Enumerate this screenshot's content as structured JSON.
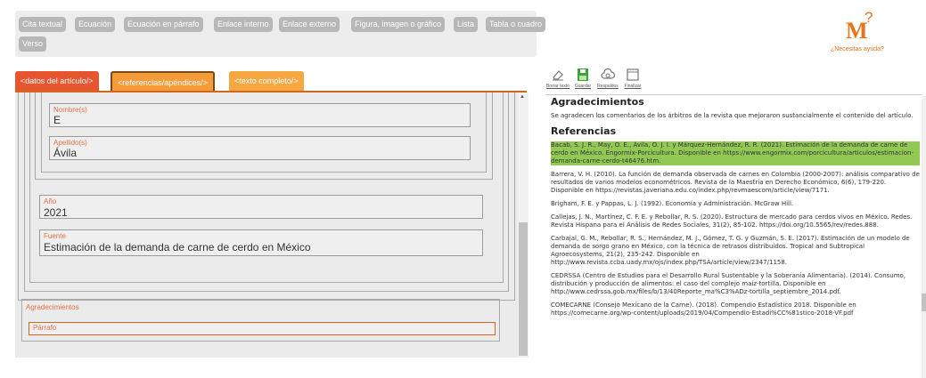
{
  "toolbar": {
    "buttons": [
      "Cita textual",
      "Ecuación",
      "Ecuación en párrafo",
      "Enlace interno",
      "Enlace externo",
      "Figura, imagen o gráfico",
      "Lista",
      "Tabla o cuadro",
      "Verso"
    ]
  },
  "help": {
    "logo": "M",
    "question_mark": "?",
    "text": "¿Necesitas ayuda?"
  },
  "tabs": [
    {
      "label": "<datos del artículo/>",
      "color": "#e8542e"
    },
    {
      "label": "<referencias/apéndices/>",
      "color": "#f59b3a"
    },
    {
      "label": "<texto completo/>",
      "color": "#f5a742"
    }
  ],
  "form": {
    "nombre": {
      "label": "Nombre(s)",
      "value": "E"
    },
    "apellido": {
      "label": "Apellido(s)",
      "value": "Ávila"
    },
    "anio": {
      "label": "Año",
      "value": "2021"
    },
    "fuente": {
      "label": "Fuente",
      "value": "Estimación de la demanda de carne de cerdo en México"
    },
    "agradecimientos": {
      "label": "Agradecimientos"
    },
    "parrafo": {
      "label": "Párrafo"
    }
  },
  "editor_tools": [
    {
      "icon": "eraser-icon",
      "label": "Borrar texto"
    },
    {
      "icon": "save-icon",
      "label": "Guardar"
    },
    {
      "icon": "cloud-icon",
      "label": "Respaldos"
    },
    {
      "icon": "finalize-icon",
      "label": "Finalizar"
    }
  ],
  "editor": {
    "agradecimientos_title": "Agradecimientos",
    "agradecimientos_text": "Se agradecen los comentarios de los árbitros de la revista que mejoraron sustancialmente el contenido del artículo.",
    "referencias_title": "Referencias",
    "references": [
      "Bacab, S. J. R., May, O. E., Ávila, O. J. I. y Márquez-Hernández, R. R. (2021). Estimación de la demanda de carne de cerdo en México. Engormix-Porcicultura. Disponible en https://www.engormix.com/porcicultura/articulos/estimacion-demanda-carne-cerdo-t46476.htm.",
      "Barrera, V. H. (2010). La función de demanda observada de carnes en Colombia (2000-2007): análisis comparativo de resultados de varios modelos econométricos. Revista de la Maestría en Derecho Económico, 6(6), 179-220. Disponible en https://revistas.javeriana.edu.co/index.php/revmaescom/article/view/7171.",
      "Brigham, F. E. y Pappas, L. J. (1992). Economía y Administración. McGraw Hill.",
      "Callejas, J. N., Martínez, C. F. E. y Rebollar, R. S. (2020). Estructura de mercado para cerdos vivos en México. Redes. Revista Hispana para el Análisis de Redes Sociales, 31(2), 85-102. https://doi.org/10.5565/rev/redes.888.",
      "Carbajal, G. M., Rebollar, R. S., Hernández, M. J., Gómez, T. G. y Guzmán, S. E. (2017). Estimación de un modelo de demanda de sorgo grano en México, con la técnica de retrasos distribuidos. Tropical and Subtropical Agroecosystems, 21(2), 235-242. Disponible en http://www.revista.ccba.uady.mx/ojs/index.php/TSA/article/view/2347/1158.",
      "CEDRSSA (Centro de Estudios para el Desarrollo Rural Sustentable y la Soberanía Alimentaria). (2014). Consumo, distribución y producción de alimentos: el caso del complejo maíz-tortilla. Disponible en http://www.cedrssa.gob.mx/files/b/13/40Reporte_ma%C3%ADz-tortilla_septiembre_2014.pdf.",
      "COMECARNE (Consejo Mexicano de la Carne). (2018). Compendio Estadístico 2018. Disponible en https://comecarne.org/wp-content/uploads/2019/04/Compendio-Estadi%CC%81stico-2018-VF.pdf"
    ]
  },
  "colors": {
    "accent": "#e8731a",
    "highlight": "#92c955",
    "toolbar_button": "#b7b7b7"
  }
}
